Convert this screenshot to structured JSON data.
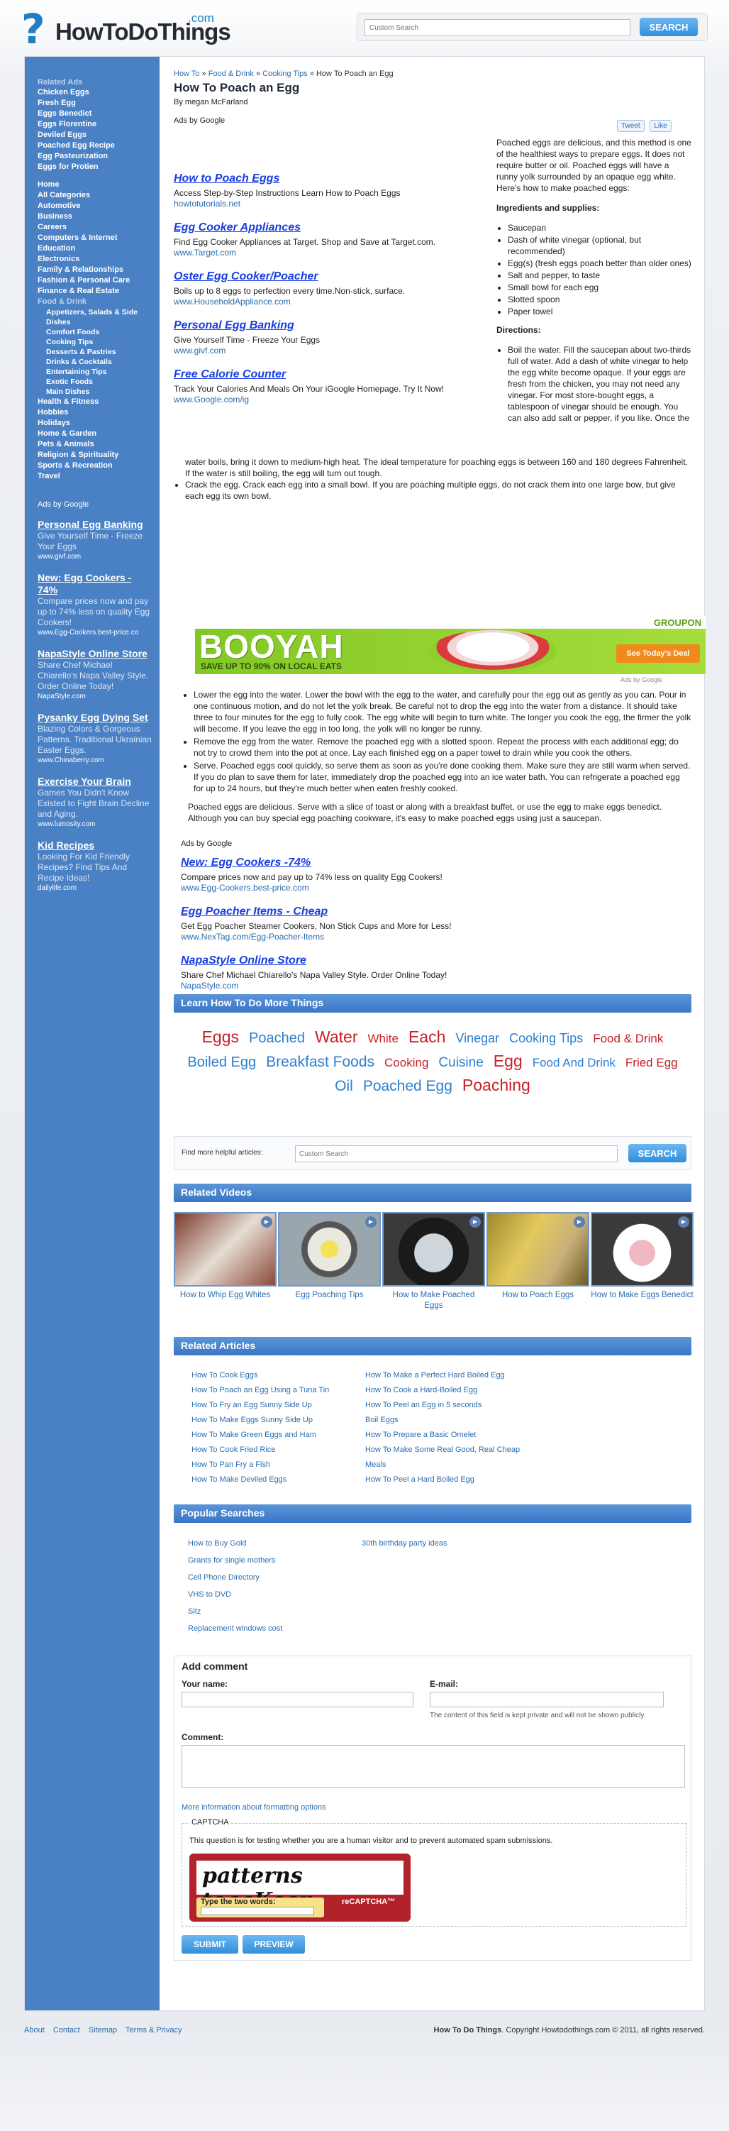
{
  "site": {
    "name": "HowToDoThings",
    "com": ".com",
    "search_placeholder": "Custom Search",
    "search_button": "SEARCH"
  },
  "sidebar": {
    "related_ads_heading": "Related Ads",
    "related_ads": [
      "Chicken Eggs",
      "Fresh Egg",
      "Eggs Benedict",
      "Eggs Florentine",
      "Deviled Eggs",
      "Poached Egg Recipe",
      "Egg Pasteurization",
      "Eggs for Protien"
    ],
    "home": "Home",
    "all_categories": "All Categories",
    "categories": [
      "Automotive",
      "Business",
      "Careers",
      "Computers & Internet",
      "Education",
      "Electronics",
      "Family & Relationships",
      "Fashion & Personal Care",
      "Finance & Real Estate"
    ],
    "food_drink": "Food & Drink",
    "food_sub": [
      "Appetizers, Salads & Side Dishes",
      "Comfort Foods",
      "Cooking Tips",
      "Desserts & Pastries",
      "Drinks & Cocktails",
      "Entertaining Tips",
      "Exotic Foods",
      "Main Dishes"
    ],
    "categories2": [
      "Health & Fitness",
      "Hobbies",
      "Holidays",
      "Home & Garden",
      "Pets & Animals",
      "Religion & Spirituality",
      "Sports & Recreation",
      "Travel"
    ],
    "ads_by": "Ads by Google",
    "ads": [
      {
        "title": "Personal Egg Banking",
        "desc": "Give Yourself Time - Freeze Your Eggs",
        "url": "www.givf.com"
      },
      {
        "title": "New: Egg Cookers - 74%",
        "desc": "Compare prices now and pay up to 74% less on quality Egg Cookers!",
        "url": "www.Egg-Cookers.best-price.co"
      },
      {
        "title": "NapaStyle Online Store",
        "desc": "Share Chef Michael Chiarello's Napa Valley Style. Order Online Today!",
        "url": "NapaStyle.com"
      },
      {
        "title": "Pysanky Egg Dying Set",
        "desc": "Blazing Colors & Gorgeous Patterns. Traditional Ukrainian Easter Eggs.",
        "url": "www.Chinaberry.com"
      },
      {
        "title": "Exercise Your Brain",
        "desc": "Games You Didn't Know Existed to Fight Brain Decline and Aging.",
        "url": "www.lumosity.com"
      },
      {
        "title": "Kid Recipes",
        "desc": "Looking For Kid Friendly Recipes? Find Tips And Recipe Ideas!",
        "url": "dailylife.com"
      }
    ]
  },
  "breadcrumb": {
    "a": "How To",
    "b": "Food & Drink",
    "c": "Cooking Tips",
    "current": "How To Poach an Egg",
    "sep": " » "
  },
  "article": {
    "title": "How To Poach an Egg",
    "byline": "By megan McFarland",
    "ads_by": "Ads by Google",
    "tweet": "Tweet",
    "like": "Like",
    "intro": "Poached eggs are delicious, and this method is one of the healthiest ways to prepare eggs. It does not require butter or oil. Poached eggs will have a runny yolk surrounded by an opaque egg white. Here's how to make poached eggs:",
    "ingredients_heading": "Ingredients and supplies:",
    "ingredients": [
      "Saucepan",
      "Dash of white vinegar (optional, but recommended)",
      "Egg(s) (fresh eggs poach better than older ones)",
      "Salt and pepper, to taste",
      "Small bowl for each egg",
      "Slotted spoon",
      "Paper towel"
    ],
    "directions_heading": "Directions:",
    "step1_part": "Boil the water. Fill the saucepan about two-thirds full of water. Add a dash of white vinegar to help the egg white become opaque. If your eggs are fresh from the chicken, you may not need any vinegar. For most store-bought eggs, a tablespoon of vinegar should be enough. You can also add salt or pepper, if you like. Once the",
    "step1_rest": "water boils, bring it down to medium-high heat. The ideal temperature for poaching eggs is between 160 and 180 degrees Fahrenheit. If the water is still boiling, the egg will turn out tough.",
    "step2": "Crack the egg. Crack each egg into a small bowl. If you are poaching multiple eggs, do not crack them into one large bow, but give each egg its own bowl.",
    "step3": "Lower the egg into the water. Lower the bowl with the egg to the water, and carefully pour the egg out as gently as you can. Pour in one continuous motion, and do not let the yolk break. Be careful not to drop the egg into the water from a distance. It should take three to four minutes for the egg to fully cook. The egg white will begin to turn white. The longer you cook the egg, the firmer the yolk will become. If you leave the egg in too long, the yolk will no longer be runny.",
    "step4": "Remove the egg from the water. Remove the poached egg with a slotted spoon. Repeat the process with each additional egg; do not try to crowd them into the pot at once. Lay each finished egg on a paper towel to drain while you cook the others.",
    "step5": "Serve. Poached eggs cool quickly, so serve them as soon as you're done cooking them. Make sure they are still warm when served. If you do plan to save them for later, immediately drop the poached egg into an ice water bath. You can refrigerate a poached egg for up to 24 hours, but they're much better when eaten freshly cooked.",
    "closing": "Poached eggs are delicious. Serve with a slice of toast or along with a breakfast buffet, or use the egg to make eggs benedict. Although you can buy special egg poaching cookware, it's easy to make poached eggs using just a saucepan."
  },
  "top_ads": [
    {
      "title": "How to Poach Eggs",
      "desc": "Access Step-by-Step Instructions Learn How to Poach Eggs",
      "url": "howtotutorials.net"
    },
    {
      "title": "Egg Cooker Appliances",
      "desc": "Find Egg Cooker Appliances at Target. Shop and Save at Target.com.",
      "url": "www.Target.com"
    },
    {
      "title": "Oster Egg Cooker/Poacher",
      "desc": "Boils up to 8 eggs to perfection every time.Non-stick, surface.",
      "url": "www.HouseholdAppliance.com"
    },
    {
      "title": "Personal Egg Banking",
      "desc": "Give Yourself Time - Freeze Your Eggs",
      "url": "www.givf.com"
    },
    {
      "title": "Free Calorie Counter",
      "desc": "Track Your Calories And Meals On Your iGoogle Homepage. Try It Now!",
      "url": "www.Google.com/ig"
    }
  ],
  "banner": {
    "headline": "BOOYAH",
    "sub": "SAVE UP TO 90% ON LOCAL EATS",
    "brand": "GROUPON",
    "button": "See Today's Deal",
    "ads_by": "Ads by Google"
  },
  "bottom_ads_by": "Ads by Google",
  "bottom_ads": [
    {
      "title": "New: Egg Cookers -74%",
      "desc": "Compare prices now and pay up to 74% less on quality Egg Cookers!",
      "url": "www.Egg-Cookers.best-price.com"
    },
    {
      "title": "Egg Poacher Items - Cheap",
      "desc": "Get Egg Poacher Steamer Cookers, Non Stick Cups and More for Less!",
      "url": "www.NexTag.com/Egg-Poacher-Items"
    },
    {
      "title": "NapaStyle Online Store",
      "desc": "Share Chef Michael Chiarello's Napa Valley Style. Order Online Today!",
      "url": "NapaStyle.com"
    }
  ],
  "learn_heading": "Learn How To Do More Things",
  "tags": [
    {
      "t": "Eggs",
      "c": "#c8202a"
    },
    {
      "t": "Poached",
      "c": "#2b7fd0"
    },
    {
      "t": "Water",
      "c": "#c8202a"
    },
    {
      "t": "White",
      "c": "#c8202a"
    },
    {
      "t": "Each",
      "c": "#c8202a"
    },
    {
      "t": "Vinegar",
      "c": "#2b7fd0"
    },
    {
      "t": "Cooking Tips",
      "c": "#2b7fd0"
    },
    {
      "t": "Food & Drink",
      "c": "#c8202a"
    },
    {
      "t": "Boiled Egg",
      "c": "#2b7fd0"
    },
    {
      "t": "Breakfast Foods",
      "c": "#2b7fd0"
    },
    {
      "t": "Cooking",
      "c": "#c8202a"
    },
    {
      "t": "Cuisine",
      "c": "#2b7fd0"
    },
    {
      "t": "Egg",
      "c": "#c8202a"
    },
    {
      "t": "Food And Drink",
      "c": "#2b7fd0"
    },
    {
      "t": "Fried Egg",
      "c": "#c8202a"
    },
    {
      "t": "Oil",
      "c": "#2b7fd0"
    },
    {
      "t": "Poached Egg",
      "c": "#2b7fd0"
    },
    {
      "t": "Poaching",
      "c": "#c8202a"
    }
  ],
  "find": {
    "label": "Find more helpful articles:",
    "placeholder": "Custom Search",
    "button": "SEARCH"
  },
  "videos_heading": "Related Videos",
  "videos": [
    "How to Whip Egg Whites",
    "Egg Poaching Tips",
    "How to Make Poached Eggs",
    "How to Poach Eggs",
    "How to Make Eggs Benedict"
  ],
  "articles_heading": "Related Articles",
  "articles_left": [
    "How To Cook Eggs",
    "How To Poach an Egg Using a Tuna Tin",
    "How To Fry an Egg Sunny Side Up",
    "How To Make Eggs Sunny Side Up",
    "How To Make Green Eggs and Ham",
    "How To Cook Fried Rice",
    "How To Pan Fry a Fish",
    "How To Make Deviled Eggs"
  ],
  "articles_right": [
    "How To Make a Perfect Hard Boiled Egg",
    "How To Cook a Hard-Boiled Egg",
    "How To Peel an Egg in 5 seconds",
    "Boil Eggs",
    "How To Prepare a Basic Omelet",
    "How To Make Some Real Good, Real Cheap Meals",
    "How To Peel a Hard Boiled Egg"
  ],
  "popular_heading": "Popular Searches",
  "popular_left": [
    "How to Buy Gold",
    "Grants for single mothers",
    "Cell Phone Directory",
    "VHS to DVD",
    "Sitz",
    "Replacement windows cost"
  ],
  "popular_right": [
    "30th birthday party ideas"
  ],
  "comment": {
    "heading": "Add comment",
    "name_label": "Your name:",
    "email_label": "E-mail:",
    "email_note": "The content of this field is kept private and will not be shown publicly.",
    "comment_label": "Comment:",
    "formatting": "More information about formatting options",
    "captcha_legend": "CAPTCHA",
    "captcha_q": "This question is for testing whether you are a human visitor and to prevent automated spam submissions.",
    "captcha_words": "patterns toaaKeor",
    "type_words": "Type the two words:",
    "recaptcha": "reCAPTCHA™",
    "submit": "SUBMIT",
    "preview": "PREVIEW"
  },
  "footer": {
    "about": "About",
    "contact": "Contact",
    "sitemap": "Sitemap",
    "terms": "Terms & Privacy",
    "brand": "How To Do Things",
    "copy": ". Copyright Howtodothings.com © 2011, all rights reserved."
  }
}
